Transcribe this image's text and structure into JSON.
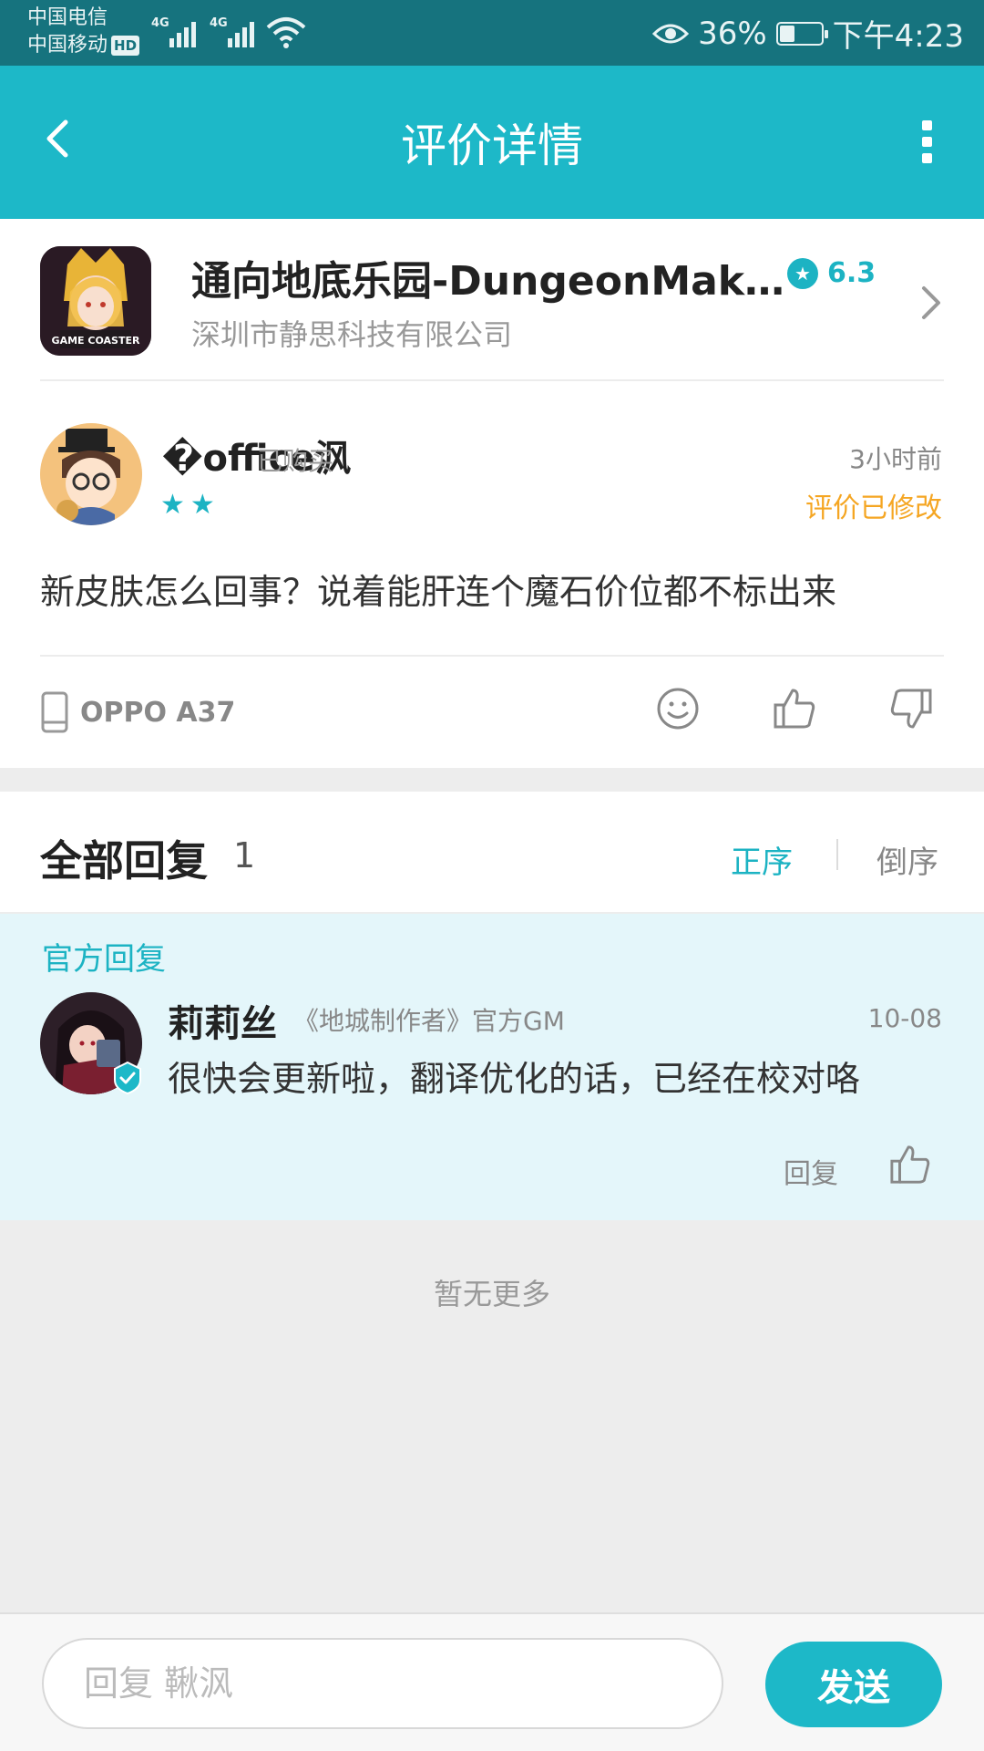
{
  "status_bar": {
    "carrier_1": "中国电信",
    "carrier_2": "中国移动",
    "hd_badge": "HD",
    "network_1": "4G",
    "network_2": "4G",
    "battery_percent": "36%",
    "battery_level": 0.36,
    "time": "下午4:23"
  },
  "app_bar": {
    "title": "评价详情",
    "back_icon": "chevron-left-icon",
    "more_icon": "more-vertical-icon"
  },
  "game": {
    "title": "通向地底乐园-DungeonMak…",
    "developer": "深圳市静思科技有限公司",
    "rating": "6.3",
    "icon_label": "GAME COASTER"
  },
  "review": {
    "username": "�office沨",
    "purchase_badge": "已购买",
    "time": "3小时前",
    "modified": "评价已修改",
    "stars_text": "★★",
    "star_count": 2,
    "content": "新皮肤怎么回事？说着能肝连个魔石价位都不标出来",
    "device": "OPPO A37"
  },
  "replies": {
    "title": "全部回复",
    "count": "1",
    "sort_asc": "正序",
    "sort_desc": "倒序"
  },
  "official_reply": {
    "label": "官方回复",
    "name": "莉莉丝",
    "role": "《地城制作者》官方GM",
    "date": "10-08",
    "text": "很快会更新啦，翻译优化的话，已经在校对咯",
    "reply_label": "回复"
  },
  "footer": {
    "no_more": "暂无更多",
    "input_placeholder": "回复 鞦沨",
    "send_label": "发送"
  },
  "colors": {
    "accent": "#1db8c8",
    "status_bar": "#16737e",
    "modified": "#f5a623",
    "official_bg": "#e4f6fa"
  }
}
